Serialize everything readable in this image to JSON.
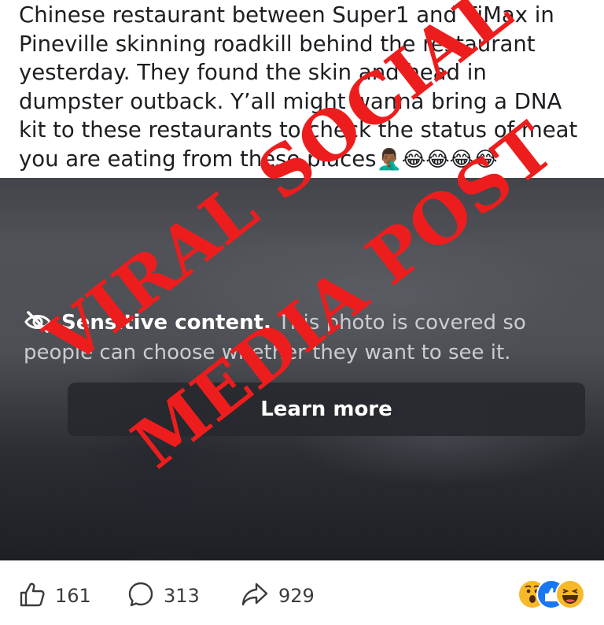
{
  "post": {
    "text": "Chinese restaurant between Super1 and TjMax in Pineville skinning roadkill behind the restaurant yesterday. They found the skin and head in dumpster outback. Y’all might wanna bring a DNA kit to these restaurants to check the status of meat you are eating from these places",
    "emojis": "🤦🏾‍♂️😂😂😂😂"
  },
  "media": {
    "sensitive_title": "Sensitive content.",
    "sensitive_body": "This photo is covered so people can choose whether they want to see it.",
    "learn_more": "Learn more"
  },
  "stamp": {
    "line1": "VIRAL SOCIAL",
    "line2": "MEDIA POST",
    "color": "#ee1d1d"
  },
  "actions": {
    "likes": "161",
    "comments": "313",
    "shares": "929",
    "reactions": [
      "wow-icon",
      "like-icon",
      "haha-icon"
    ]
  }
}
